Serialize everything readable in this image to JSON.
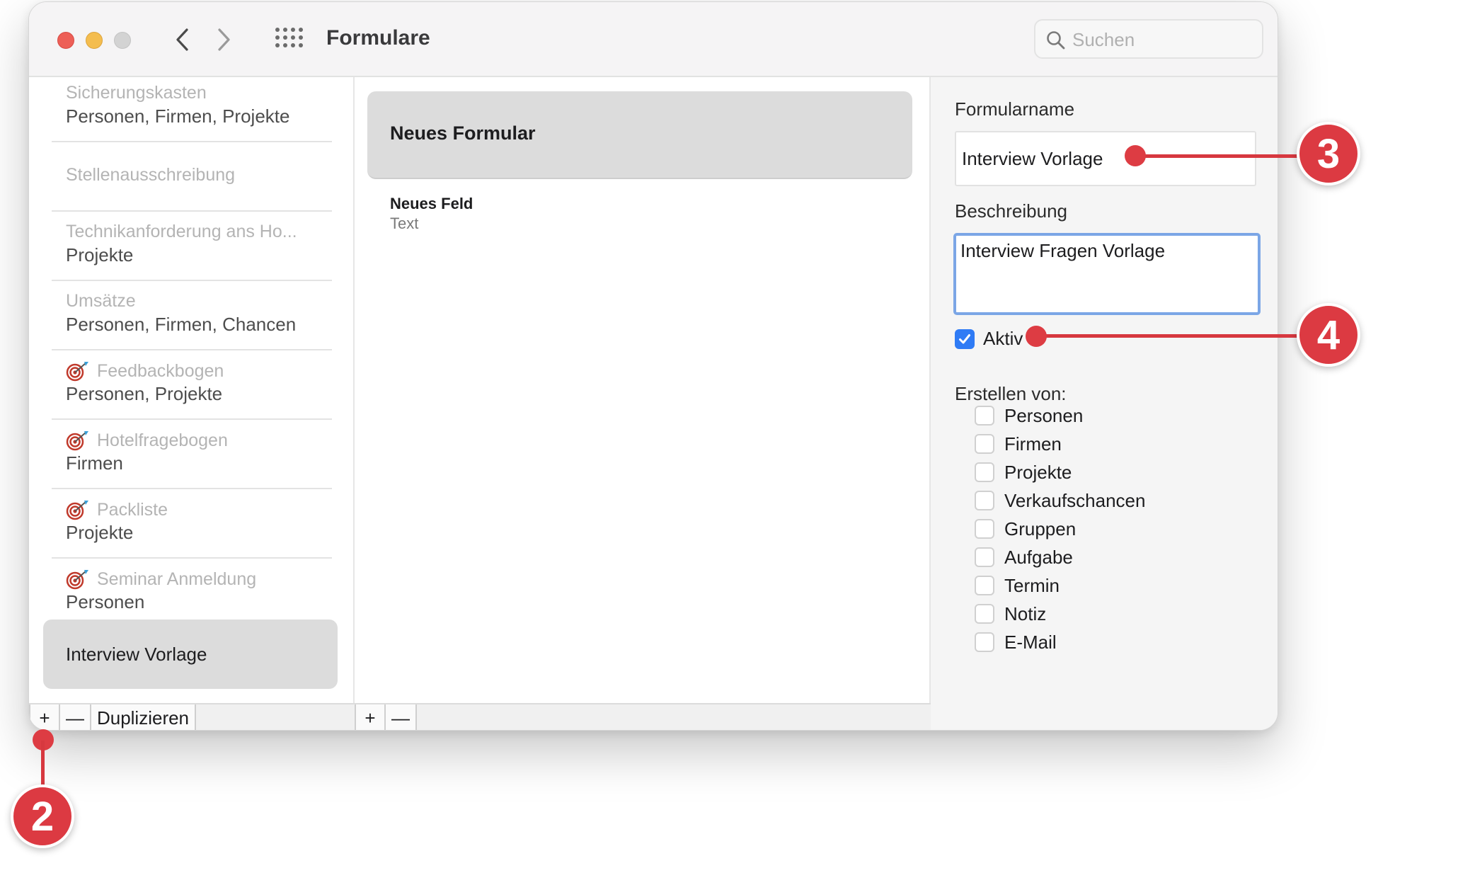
{
  "window": {
    "title": "Formulare",
    "search_placeholder": "Suchen"
  },
  "sidebar": {
    "items": [
      {
        "name": "Sicherungskasten",
        "types": "Personen, Firmen, Projekte",
        "icon": null
      },
      {
        "name": "Stellenausschreibung",
        "types": "",
        "icon": null
      },
      {
        "name": "Technikanforderung ans Ho...",
        "types": "Projekte",
        "icon": null
      },
      {
        "name": "Umsätze",
        "types": "Personen, Firmen, Chancen",
        "icon": null
      },
      {
        "name": "Feedbackbogen",
        "types": "Personen, Projekte",
        "icon": "target-icon"
      },
      {
        "name": "Hotelfragebogen",
        "types": "Firmen",
        "icon": "target-icon"
      },
      {
        "name": "Packliste",
        "types": "Projekte",
        "icon": "target-icon"
      },
      {
        "name": "Seminar Anmeldung",
        "types": "Personen",
        "icon": "target-icon"
      }
    ],
    "selected": "Interview Vorlage",
    "buttons": {
      "add": "+",
      "remove": "—",
      "duplicate": "Duplizieren"
    }
  },
  "middle": {
    "header": "Neues Formular",
    "fields": [
      {
        "name": "Neues Feld",
        "type": "Text"
      }
    ],
    "buttons": {
      "add": "+",
      "remove": "—"
    }
  },
  "inspector": {
    "name_label": "Formularname",
    "name_value": "Interview Vorlage",
    "description_label": "Beschreibung",
    "description_value": "Interview Fragen Vorlage",
    "active_label": "Aktiv",
    "active_checked": true,
    "create_from_label": "Erstellen von:",
    "create_from_options": [
      "Personen",
      "Firmen",
      "Projekte",
      "Verkaufschancen",
      "Gruppen",
      "Aufgabe",
      "Termin",
      "Notiz",
      "E-Mail"
    ]
  },
  "callouts": {
    "two": "2",
    "three": "3",
    "four": "4"
  },
  "colors": {
    "accent": "#2f7bf5",
    "callout": "#dc3a42",
    "selection": "#dcdcdc"
  }
}
